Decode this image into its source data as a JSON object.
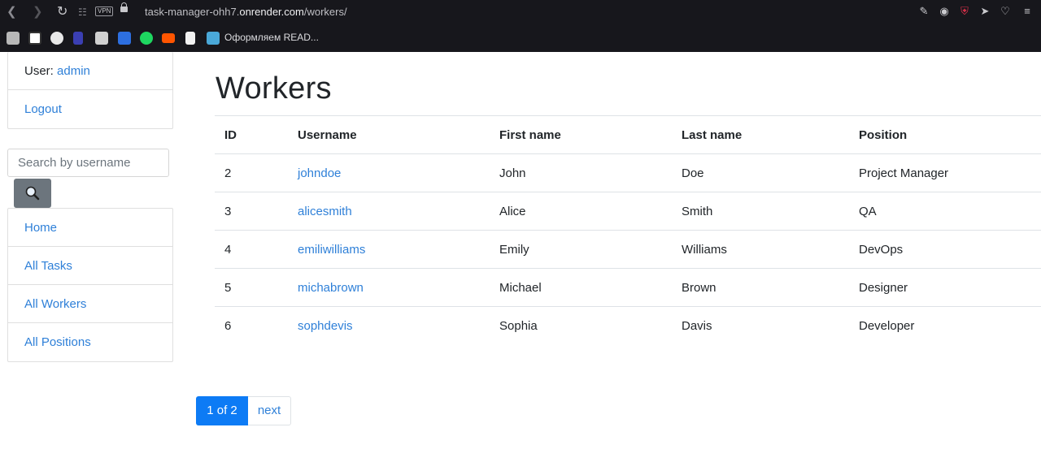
{
  "browser": {
    "url_prefix": "task-manager-ohh7.",
    "url_domain": "onrender.com",
    "url_path": "/workers/",
    "vpn_label": "VPN",
    "bookmark_label": "Оформляем READ...",
    "icons": [
      "back-icon",
      "forward-icon",
      "reload-icon",
      "grid-icon",
      "lock-icon",
      "edit-icon",
      "camera-icon",
      "shield-icon",
      "send-icon",
      "heart-icon"
    ]
  },
  "sidebar": {
    "user_prefix": "User:",
    "user_name": "admin",
    "logout": "Logout",
    "search_placeholder": "Search by username",
    "nav": [
      {
        "label": "Home"
      },
      {
        "label": "All Tasks"
      },
      {
        "label": "All Workers"
      },
      {
        "label": "All Positions"
      }
    ]
  },
  "main": {
    "title": "Workers",
    "table": {
      "headers": [
        "ID",
        "Username",
        "First name",
        "Last name",
        "Position"
      ],
      "rows": [
        {
          "id": "2",
          "username": "johndoe",
          "first": "John",
          "last": "Doe",
          "position": "Project Manager"
        },
        {
          "id": "3",
          "username": "alicesmith",
          "first": "Alice",
          "last": "Smith",
          "position": "QA"
        },
        {
          "id": "4",
          "username": "emiliwilliams",
          "first": "Emily",
          "last": "Williams",
          "position": "DevOps"
        },
        {
          "id": "5",
          "username": "michabrown",
          "first": "Michael",
          "last": "Brown",
          "position": "Designer"
        },
        {
          "id": "6",
          "username": "sophdevis",
          "first": "Sophia",
          "last": "Davis",
          "position": "Developer"
        }
      ]
    },
    "pagination": {
      "current": "1 of 2",
      "next": "next"
    }
  },
  "colors": {
    "link": "#2f80d8",
    "primary": "#0d7bf5",
    "search_button": "#6c757d",
    "chrome": "#17171c"
  }
}
